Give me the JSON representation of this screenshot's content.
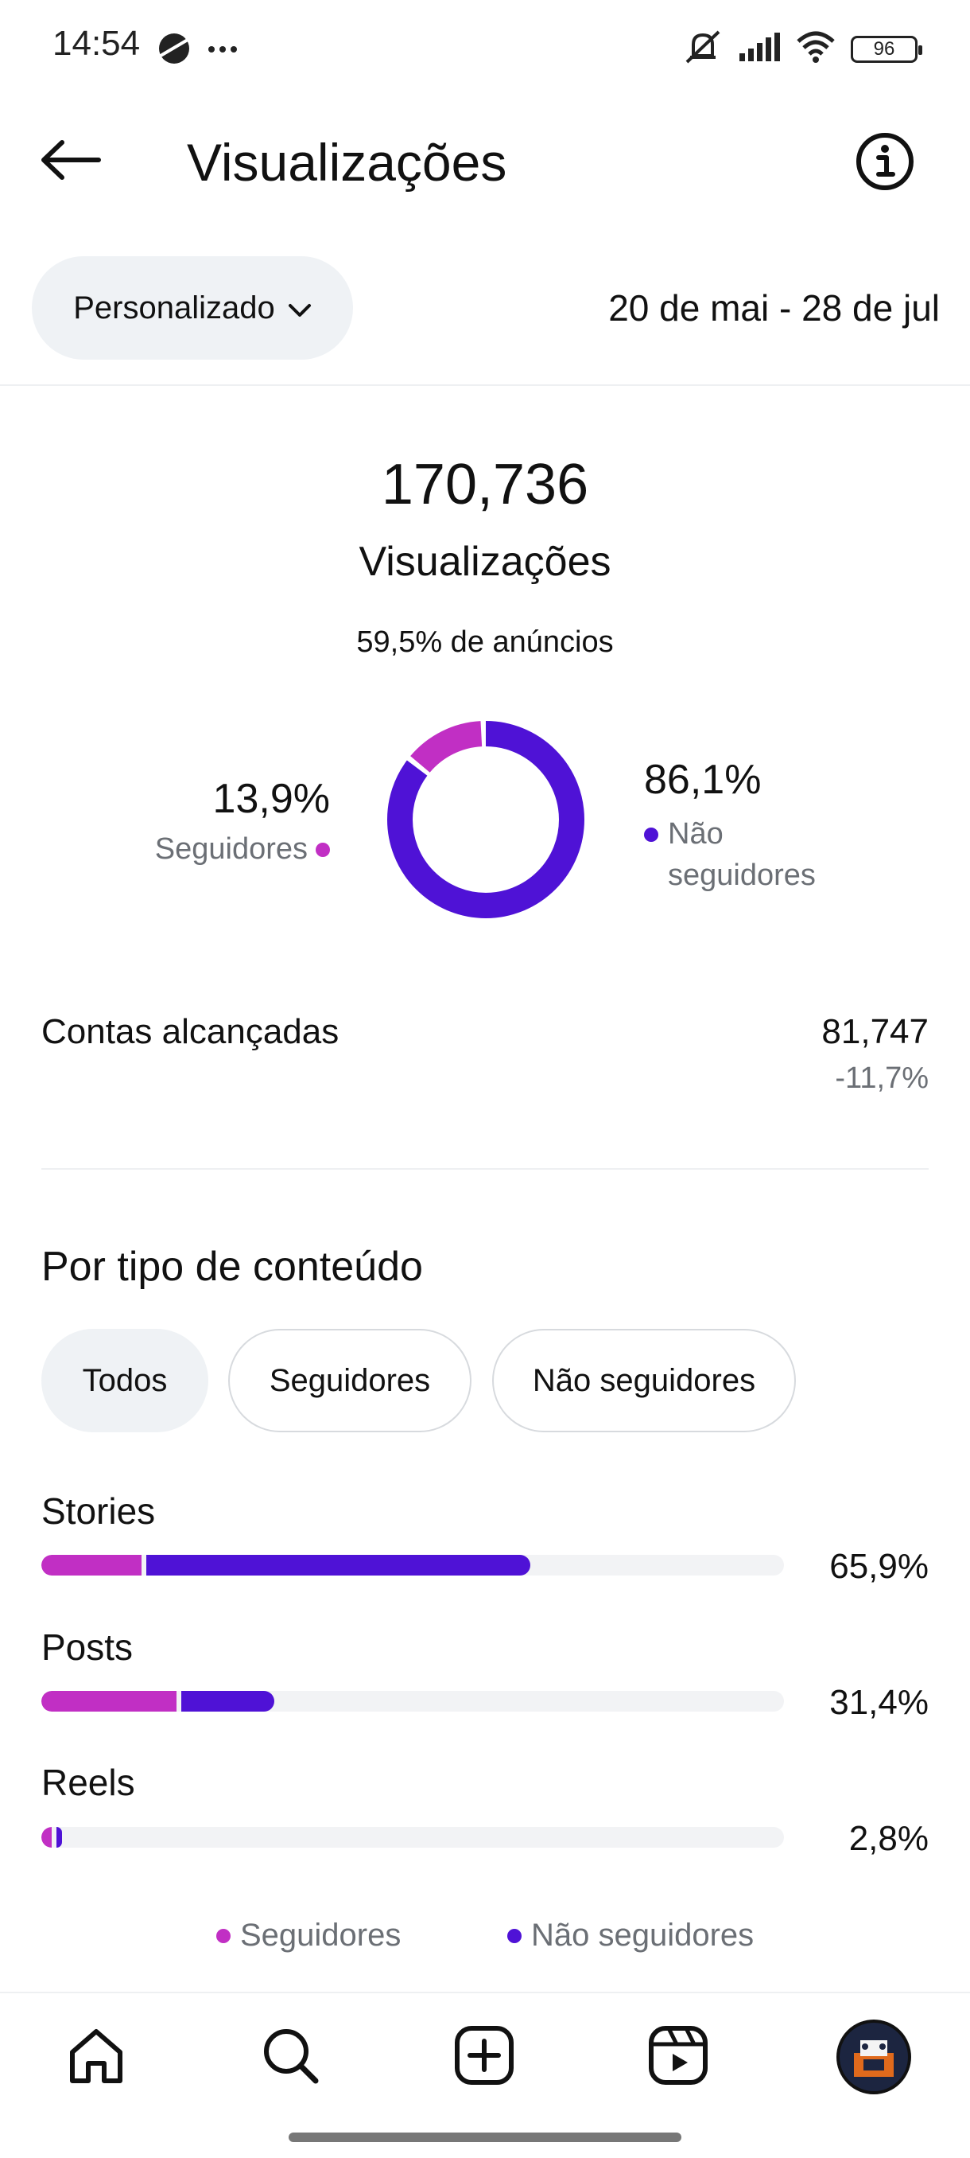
{
  "status_bar": {
    "time": "14:54",
    "battery": "96",
    "icons": [
      "planet-icon",
      "more-dots-icon",
      "mute-icon",
      "signal-icon",
      "wifi-icon",
      "battery-icon"
    ]
  },
  "header": {
    "title": "Visualizações",
    "back_icon": "arrow-left-icon",
    "info_icon": "info-icon"
  },
  "filter": {
    "period_label": "Personalizado",
    "date_range": "20 de mai - 28 de jul"
  },
  "summary": {
    "total": "170,736",
    "total_label": "Visualizações",
    "ads_text": "59,5% de anúncios"
  },
  "audience": {
    "followers_pct": "13,9%",
    "followers_label": "Seguidores",
    "nonfollowers_pct": "86,1%",
    "nonfollowers_label_1": "Não",
    "nonfollowers_label_2": "seguidores",
    "followers_fraction": 0.139,
    "nonfollowers_fraction": 0.861
  },
  "reach": {
    "label": "Contas alcançadas",
    "value": "81,747",
    "change": "-11,7%"
  },
  "content_type": {
    "title": "Por tipo de conteúdo",
    "tabs": [
      "Todos",
      "Seguidores",
      "Não seguidores"
    ],
    "rows": [
      {
        "label": "Stories",
        "pct": "65,9%",
        "followers_fraction": 0.135,
        "nonfollowers_fraction": 0.524
      },
      {
        "label": "Posts",
        "pct": "31,4%",
        "followers_fraction": 0.182,
        "nonfollowers_fraction": 0.132
      },
      {
        "label": "Reels",
        "pct": "2,8%",
        "followers_fraction": 0.014,
        "nonfollowers_fraction": 0.014
      }
    ],
    "legend": [
      "Seguidores",
      "Não seguidores"
    ]
  },
  "colors": {
    "followers": "#c12fc4",
    "nonfollowers": "#4f12d6",
    "track": "#f2f3f5"
  },
  "bottom_nav": [
    "home-icon",
    "search-icon",
    "create-icon",
    "reels-icon",
    "profile-avatar"
  ]
}
